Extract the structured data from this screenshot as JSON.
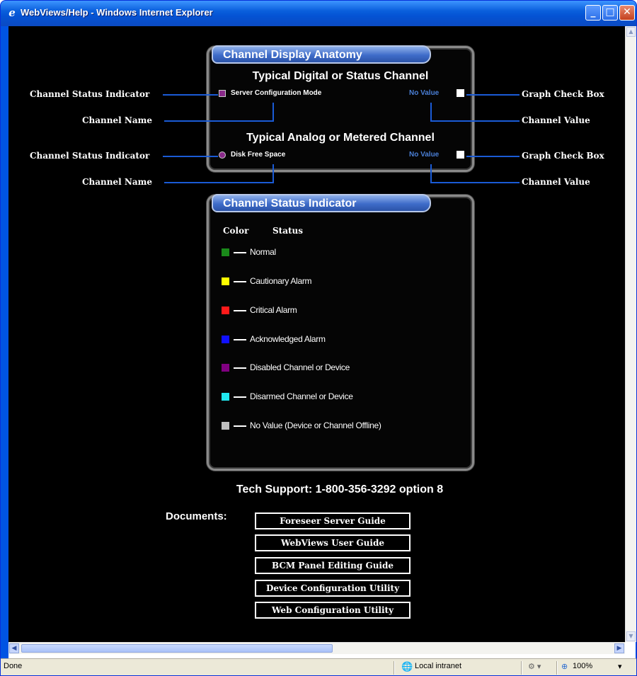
{
  "window": {
    "title": "WebViews/Help - Windows Internet Explorer",
    "buttons": {
      "minimize": "_",
      "maximize": "□",
      "close": "✕"
    }
  },
  "anatomy": {
    "title": "Channel Display Anatomy",
    "digital_heading": "Typical Digital or Status Channel",
    "digital_channel_name": "Server Configuration Mode",
    "digital_value": "No Value",
    "analog_heading": "Typical Analog or Metered Channel",
    "analog_channel_name": "Disk Free Space",
    "analog_value": "No Value",
    "left_labels": [
      "Channel Status Indicator",
      "Channel Name",
      "Channel Status Indicator",
      "Channel Name"
    ],
    "right_labels": [
      "Graph Check Box",
      "Channel Value",
      "Graph Check Box",
      "Channel Value"
    ],
    "status_color": "#8a2a8a",
    "value_color": "#4a7fd6"
  },
  "status_indicator": {
    "title": "Channel Status Indicator",
    "col_color": "Color",
    "col_status": "Status",
    "items": [
      {
        "label": "Normal",
        "color": "#1a8a1a"
      },
      {
        "label": "Cautionary Alarm",
        "color": "#ffff00"
      },
      {
        "label": "Critical Alarm",
        "color": "#ff1a1a"
      },
      {
        "label": "Acknowledged Alarm",
        "color": "#1010ff"
      },
      {
        "label": "Disabled Channel or Device",
        "color": "#800080"
      },
      {
        "label": "Disarmed Channel or Device",
        "color": "#20e8f0"
      },
      {
        "label": "No Value (Device or Channel Offline)",
        "color": "#c0c0c0"
      }
    ]
  },
  "support": {
    "text": "Tech Support: 1-800-356-3292 option 8"
  },
  "documents": {
    "label": "Documents:",
    "buttons": [
      "Foreseer Server Guide",
      "WebViews User Guide",
      "BCM Panel Editing Guide",
      "Device Configuration Utility",
      "Web Configuration Utility"
    ]
  },
  "statusbar": {
    "status": "Done",
    "zone": "Local intranet",
    "zoom": "100%"
  }
}
